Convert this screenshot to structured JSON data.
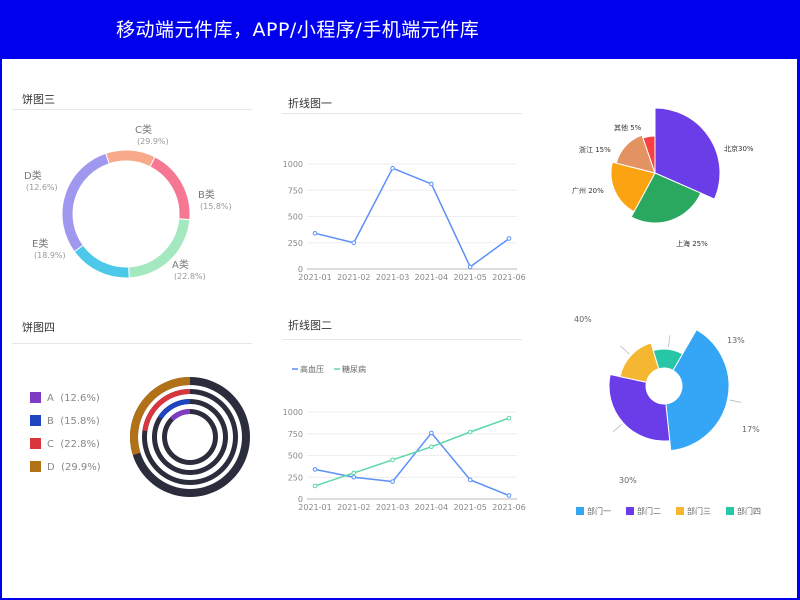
{
  "header": {
    "title": "移动端元件库，APP/小程序/手机端元件库"
  },
  "colors": {
    "header_bg": "#0000ee",
    "line_blue": "#5b8ff9",
    "line_green": "#5ad8a6"
  },
  "sections": {
    "pie3": {
      "title": "饼图三"
    },
    "pie4": {
      "title": "饼图四"
    },
    "line1": {
      "title": "折线图一"
    },
    "line2": {
      "title": "折线图二"
    }
  },
  "chart_data": [
    {
      "id": "pie3",
      "type": "pie",
      "title": "饼图三",
      "slices": [
        {
          "label": "A类",
          "pct_label": "(22.8%)",
          "value": 22.8,
          "color": "#a4e8c0"
        },
        {
          "label": "B类",
          "pct_label": "(15.8%)",
          "value": 15.8,
          "color": "#4cc9e8"
        },
        {
          "label": "C类",
          "pct_label": "(29.9%)",
          "value": 29.9,
          "color": "#9f98ee"
        },
        {
          "label": "D类",
          "pct_label": "(12.6%)",
          "value": 12.6,
          "color": "#f8a98a"
        },
        {
          "label": "E类",
          "pct_label": "(18.9%)",
          "value": 18.9,
          "color": "#f67791"
        }
      ]
    },
    {
      "id": "line1",
      "type": "line",
      "title": "折线图一",
      "categories": [
        "2021-01",
        "2021-02",
        "2021-03",
        "2021-04",
        "2021-05",
        "2021-06"
      ],
      "yticks": [
        "0",
        "250",
        "500",
        "750",
        "1000"
      ],
      "ylim": [
        0,
        1000
      ],
      "series": [
        {
          "values": [
            340,
            250,
            960,
            810,
            20,
            290
          ],
          "color": "#5b8ff9"
        }
      ]
    },
    {
      "id": "pie_rose",
      "type": "pie",
      "slices": [
        {
          "label": "北京30%",
          "value": 30,
          "color": "#6a3de8"
        },
        {
          "label": "上海 25%",
          "value": 25,
          "color": "#2aa860"
        },
        {
          "label": "广州 20%",
          "value": 20,
          "color": "#fca311"
        },
        {
          "label": "浙江 15%",
          "value": 15,
          "color": "#e39361"
        },
        {
          "label": "其他 5%",
          "value": 5,
          "color": "#f94144"
        }
      ]
    },
    {
      "id": "pie4",
      "type": "pie",
      "title": "饼图四",
      "legend": [
        {
          "label": "A",
          "pct_label": "(12.6%)",
          "value": 12.6,
          "color": "#7d3cc2"
        },
        {
          "label": "B",
          "pct_label": "(15.8%)",
          "value": 15.8,
          "color": "#1d45c0"
        },
        {
          "label": "C",
          "pct_label": "(22.8%)",
          "value": 22.8,
          "color": "#d8353c"
        },
        {
          "label": "D",
          "pct_label": "(29.9%)",
          "value": 29.9,
          "color": "#b07117"
        }
      ],
      "track_color": "#2b2d3d"
    },
    {
      "id": "line2",
      "type": "line",
      "title": "折线图二",
      "categories": [
        "2021-01",
        "2021-02",
        "2021-03",
        "2021-04",
        "2021-05",
        "2021-06"
      ],
      "yticks": [
        "0",
        "250",
        "500",
        "750",
        "1000"
      ],
      "ylim": [
        0,
        1000
      ],
      "series": [
        {
          "name": "高血压",
          "values": [
            340,
            250,
            200,
            760,
            220,
            40
          ],
          "color": "#5b8ff9"
        },
        {
          "name": "糖尿病",
          "values": [
            150,
            300,
            450,
            600,
            770,
            930
          ],
          "color": "#5ad8a6"
        }
      ]
    },
    {
      "id": "pie_dept",
      "type": "pie",
      "slices": [
        {
          "label": "部门一",
          "pct_label": "40%",
          "value": 40,
          "color": "#35a5f5"
        },
        {
          "label": "部门二",
          "pct_label": "30%",
          "value": 30,
          "color": "#6a3de8"
        },
        {
          "label": "部门三",
          "pct_label": "17%",
          "value": 17,
          "color": "#f5b731"
        },
        {
          "label": "部门四",
          "pct_label": "13%",
          "value": 13,
          "color": "#27c6a6"
        }
      ]
    }
  ]
}
